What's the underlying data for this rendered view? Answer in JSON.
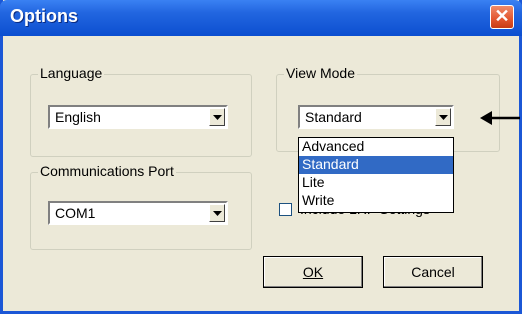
{
  "window": {
    "title": "Options",
    "close_glyph": "✕"
  },
  "language": {
    "legend": "Language",
    "selected": "English"
  },
  "comm_port": {
    "legend": "Communications Port",
    "selected": "COM1"
  },
  "view_mode": {
    "legend": "View Mode",
    "selected": "Standard",
    "options": [
      "Advanced",
      "Standard",
      "Lite",
      "Write"
    ]
  },
  "checkbox": {
    "label": "Include LRF Settings",
    "checked": false
  },
  "buttons": {
    "ok": "OK",
    "cancel": "Cancel"
  },
  "colors": {
    "title_bar": "#0c4fd0",
    "selection": "#316ac5",
    "face": "#ece9d8"
  },
  "icons": {
    "close": "close-icon",
    "dropdown": "chevron-down-icon",
    "pointer": "arrow-left-icon"
  }
}
